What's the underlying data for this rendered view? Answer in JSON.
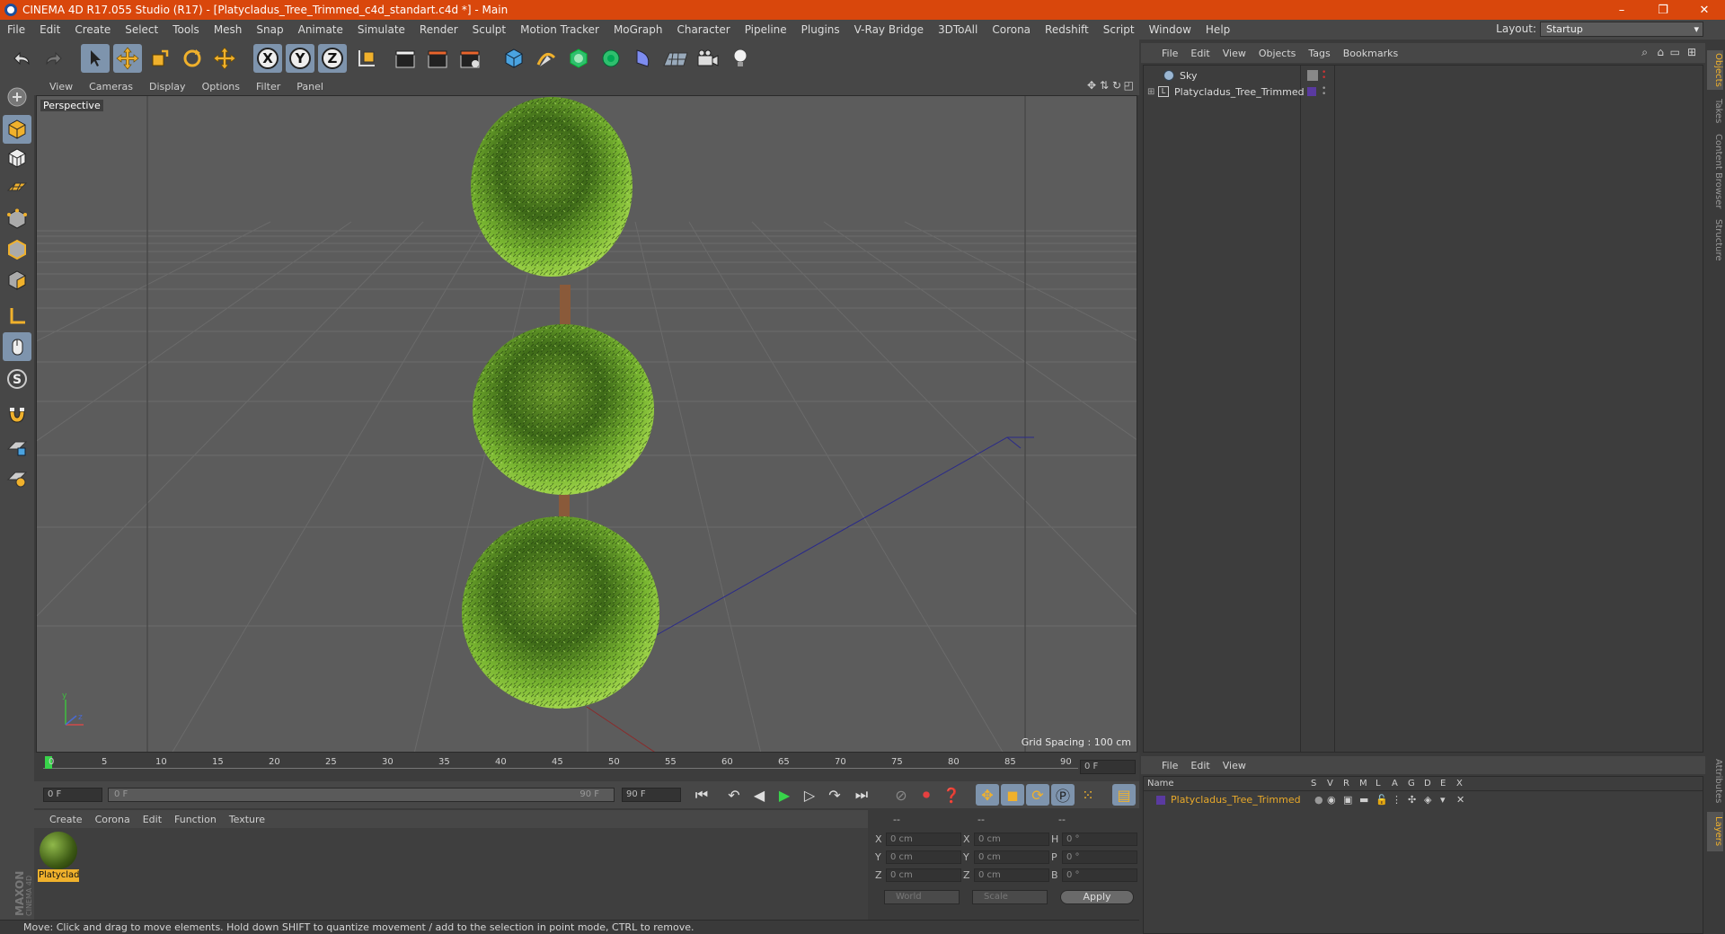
{
  "window": {
    "title": "CINEMA 4D R17.055 Studio (R17) - [Platycladus_Tree_Trimmed_c4d_standart.c4d *] - Main",
    "controls": {
      "minimize": "–",
      "maximize": "❐",
      "close": "✕"
    }
  },
  "menubar": {
    "items": [
      "File",
      "Edit",
      "Create",
      "Select",
      "Tools",
      "Mesh",
      "Snap",
      "Animate",
      "Simulate",
      "Render",
      "Sculpt",
      "Motion Tracker",
      "MoGraph",
      "Character",
      "Pipeline",
      "Plugins",
      "V-Ray Bridge",
      "3DToAll",
      "Corona",
      "Redshift",
      "Script",
      "Window",
      "Help"
    ],
    "layout_label": "Layout:",
    "layout_value": "Startup"
  },
  "toolbar": {
    "axis_x": "X",
    "axis_y": "Y",
    "axis_z": "Z"
  },
  "viewport": {
    "menu": [
      "View",
      "Cameras",
      "Display",
      "Options",
      "Filter",
      "Panel"
    ],
    "label": "Perspective",
    "grid_spacing": "Grid Spacing : 100 cm"
  },
  "timeline": {
    "ticks": [
      "0",
      "5",
      "10",
      "15",
      "20",
      "25",
      "30",
      "35",
      "40",
      "45",
      "50",
      "55",
      "60",
      "65",
      "70",
      "75",
      "80",
      "85",
      "90"
    ],
    "current_frame": "0 F",
    "start_field": "0 F",
    "range_start": "0 F",
    "range_end": "90 F",
    "end_field": "90 F",
    "end_frame_display": "0 F"
  },
  "materials": {
    "menu": [
      "Create",
      "Corona",
      "Edit",
      "Function",
      "Texture"
    ],
    "items": [
      {
        "name": "Platyclad"
      }
    ]
  },
  "coordinates": {
    "headers": [
      "--",
      "--",
      "--"
    ],
    "rows": [
      {
        "l1": "X",
        "v1": "0 cm",
        "l2": "X",
        "v2": "0 cm",
        "l3": "H",
        "v3": "0 °"
      },
      {
        "l1": "Y",
        "v1": "0 cm",
        "l2": "Y",
        "v2": "0 cm",
        "l3": "P",
        "v3": "0 °"
      },
      {
        "l1": "Z",
        "v1": "0 cm",
        "l2": "Z",
        "v2": "0 cm",
        "l3": "B",
        "v3": "0 °"
      }
    ],
    "mode1": "World",
    "mode2": "Scale",
    "apply": "Apply"
  },
  "objects": {
    "menu": [
      "File",
      "Edit",
      "View",
      "Objects",
      "Tags",
      "Bookmarks"
    ],
    "items": [
      {
        "name": "Sky"
      },
      {
        "name": "Platycladus_Tree_Trimmed"
      }
    ]
  },
  "layers": {
    "menu": [
      "File",
      "Edit",
      "View"
    ],
    "columns": [
      "Name",
      "S",
      "V",
      "R",
      "M",
      "L",
      "A",
      "G",
      "D",
      "E",
      "X"
    ],
    "items": [
      {
        "name": "Platycladus_Tree_Trimmed",
        "color": "#5a3aa0"
      }
    ]
  },
  "sidetabs": [
    "Objects",
    "Takes",
    "Content Browser",
    "Structure",
    "Attributes",
    "Layers"
  ],
  "status": "Move: Click and drag to move elements. Hold down SHIFT to quantize movement / add to the selection in point mode, CTRL to remove.",
  "colors": {
    "titlebar": "#d9470c",
    "accent_blue": "#7e94ad",
    "foliage": "#7fc232",
    "layer_text": "#e8a92a"
  }
}
